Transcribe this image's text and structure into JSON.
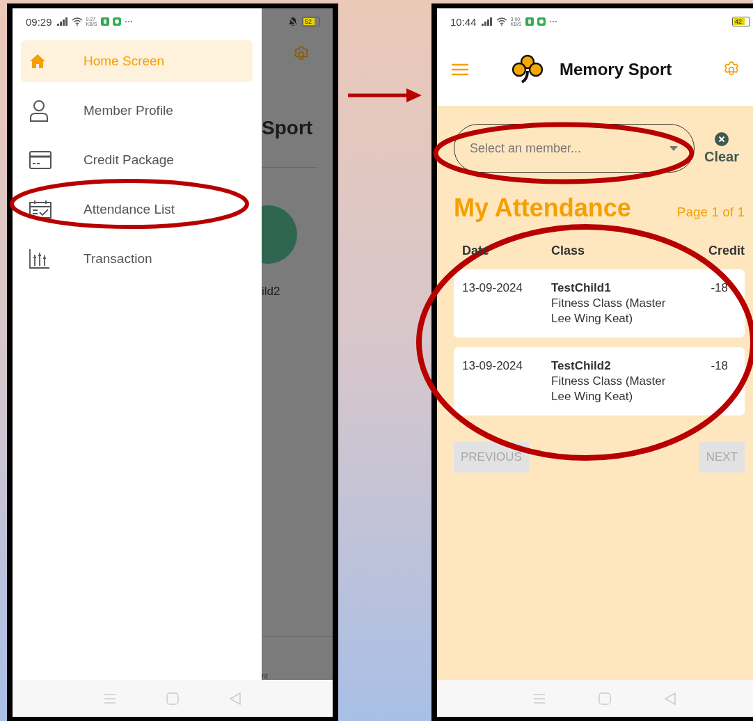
{
  "left_screen": {
    "status_bar": {
      "time": "09:29",
      "net_speed": "0.27",
      "net_unit": "KB/S",
      "battery": "52"
    },
    "drawer": {
      "items": [
        {
          "label": "Home Screen",
          "kind": "home",
          "selected": true
        },
        {
          "label": "Member Profile",
          "kind": "person",
          "selected": false
        },
        {
          "label": "Credit Package",
          "kind": "card",
          "selected": false
        },
        {
          "label": "Attendance List",
          "kind": "calendar",
          "selected": false
        },
        {
          "label": "Transaction",
          "kind": "chart",
          "selected": false
        }
      ]
    },
    "background_page": {
      "title_fragment": "Sport",
      "name_fragment": "ild2",
      "footer_fragment": "nt"
    }
  },
  "right_screen": {
    "status_bar": {
      "time": "10:44",
      "net_speed": "3.00",
      "net_unit": "KB/S",
      "battery": "42"
    },
    "app_bar": {
      "title": "Memory Sport"
    },
    "member_select": {
      "placeholder": "Select an member..."
    },
    "clear_button": {
      "label": "Clear"
    },
    "heading": "My Attendance",
    "page_info": "Page 1 of 1",
    "columns": [
      "Date",
      "Class",
      "Credit"
    ],
    "rows": [
      {
        "date": "13-09-2024",
        "member": "TestChild1",
        "class": "Fitness Class (Master Lee Wing Keat)",
        "credit": "-18"
      },
      {
        "date": "13-09-2024",
        "member": "TestChild2",
        "class": "Fitness Class (Master Lee Wing Keat)",
        "credit": "-18"
      }
    ],
    "previous_button": {
      "label": "PREVIOUS",
      "disabled": true
    },
    "next_button": {
      "label": "NEXT",
      "disabled": true
    }
  }
}
